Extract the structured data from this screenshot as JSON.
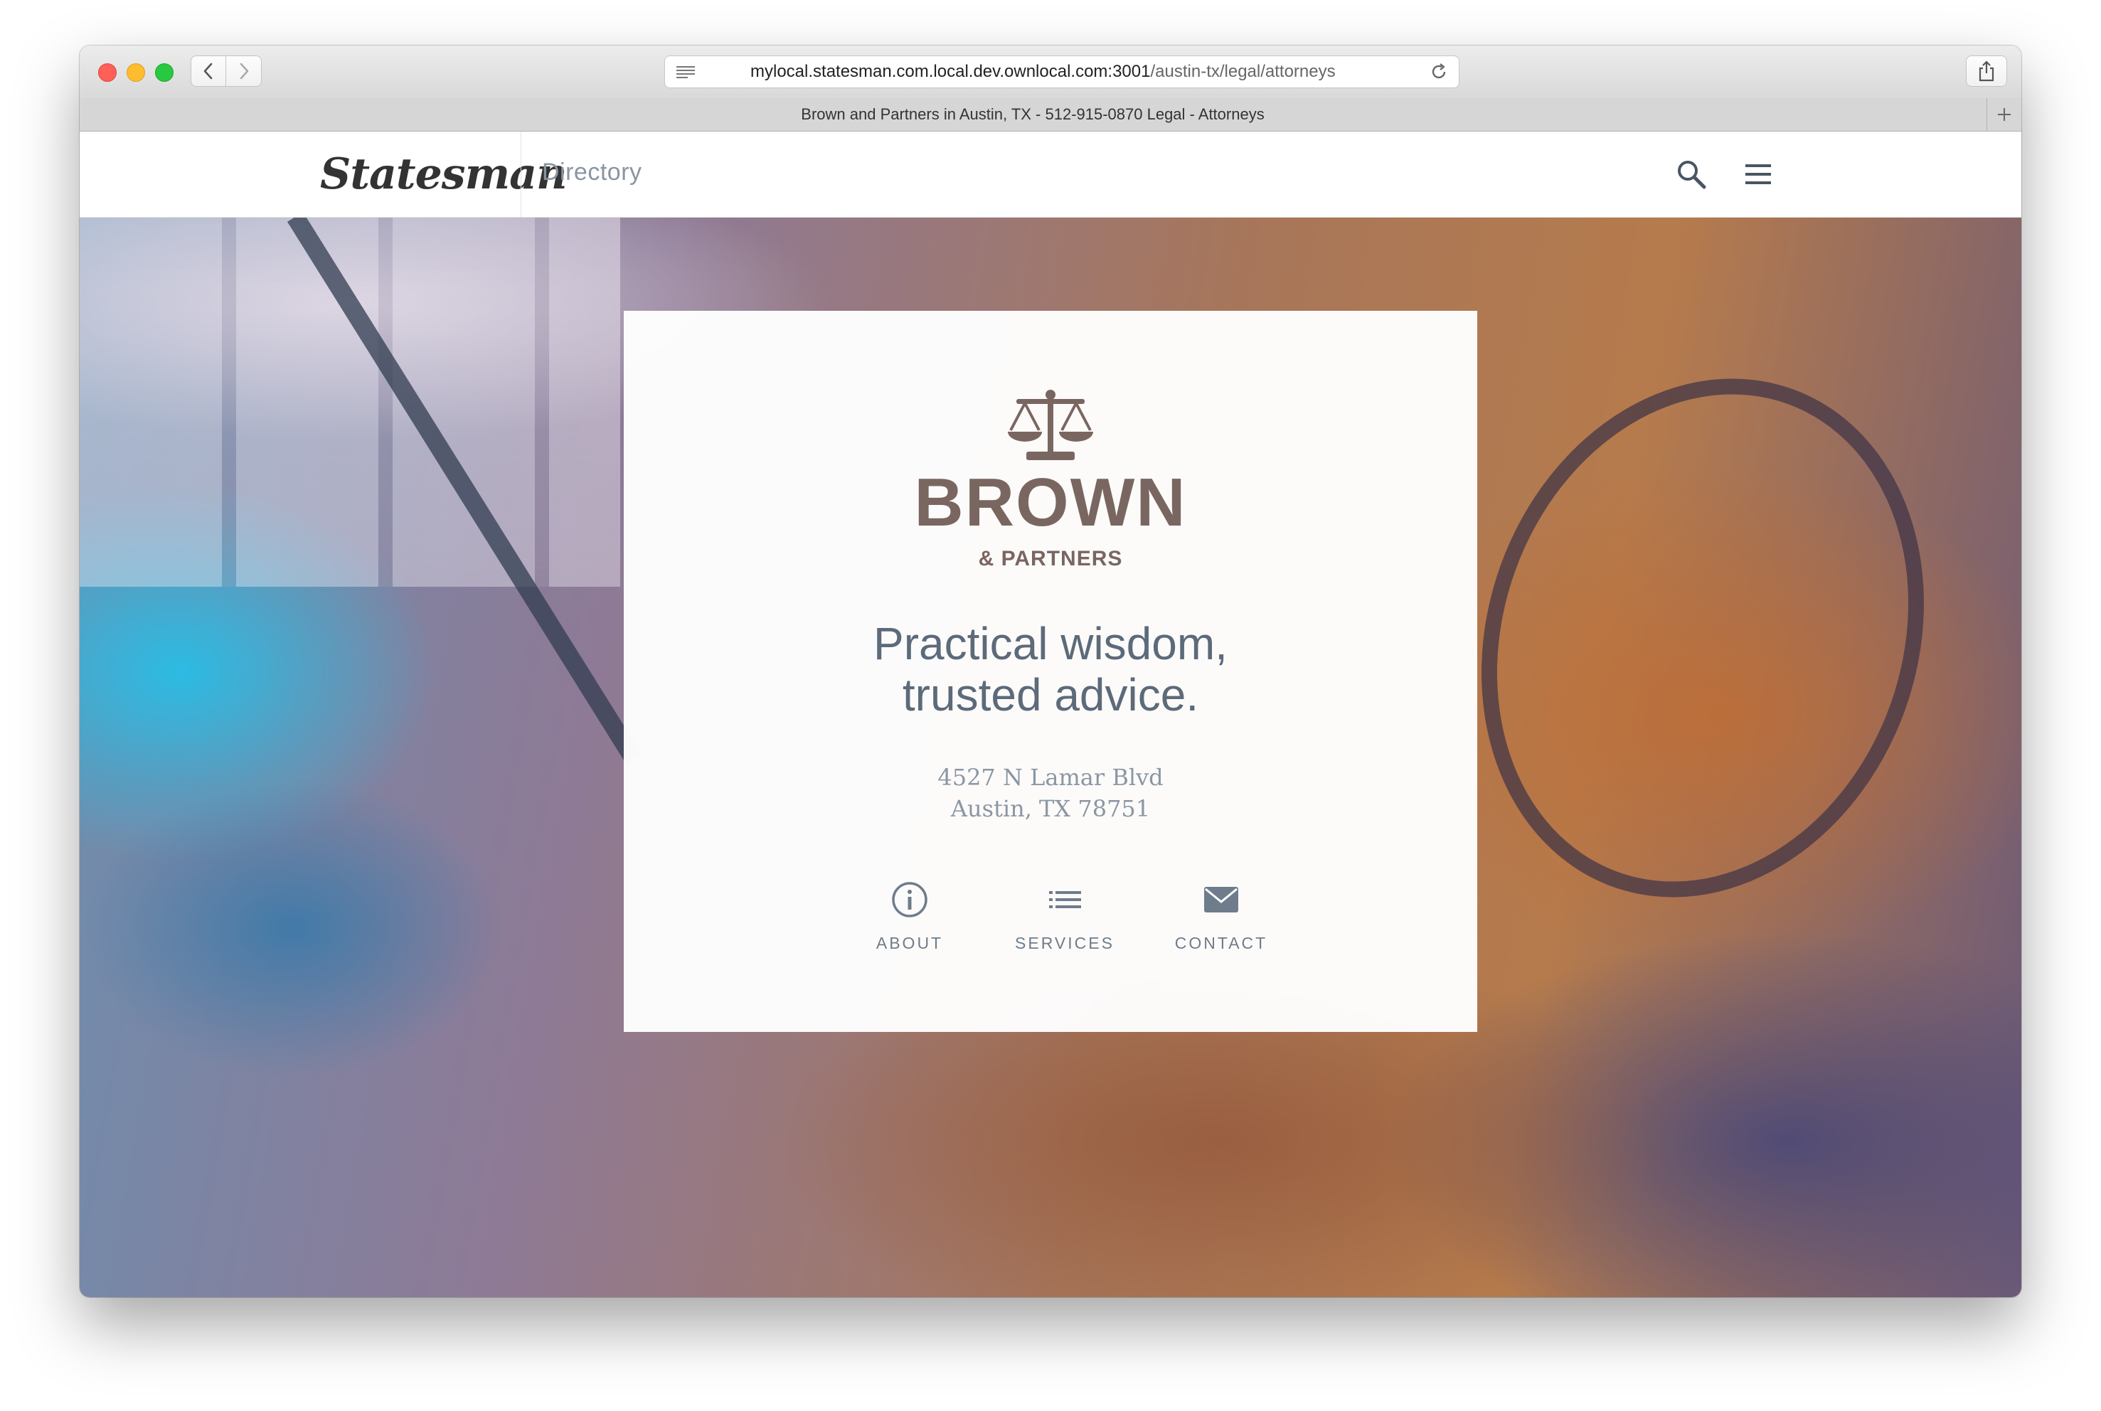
{
  "browser": {
    "url_host": "mylocal.statesman.com.local.dev.ownlocal.com:3001",
    "url_path": "/austin-tx/legal/attorneys",
    "tab_title": "Brown and Partners in Austin, TX - 512-915-0870 Legal - Attorneys"
  },
  "header": {
    "logo": "Statesman",
    "directory_label": "Directory"
  },
  "card": {
    "brand_name": "BROWN",
    "brand_sub": "& PARTNERS",
    "tagline_line1": "Practical wisdom,",
    "tagline_line2": "trusted advice.",
    "address_line1": "4527 N Lamar Blvd",
    "address_line2": "Austin, TX 78751",
    "actions": [
      {
        "label": "ABOUT",
        "icon": "info-icon"
      },
      {
        "label": "SERVICES",
        "icon": "list-icon"
      },
      {
        "label": "CONTACT",
        "icon": "mail-icon"
      }
    ]
  },
  "colors": {
    "brand": "#7a6660",
    "action_text": "#6f7c8b",
    "tagline": "#5c6a7a"
  }
}
